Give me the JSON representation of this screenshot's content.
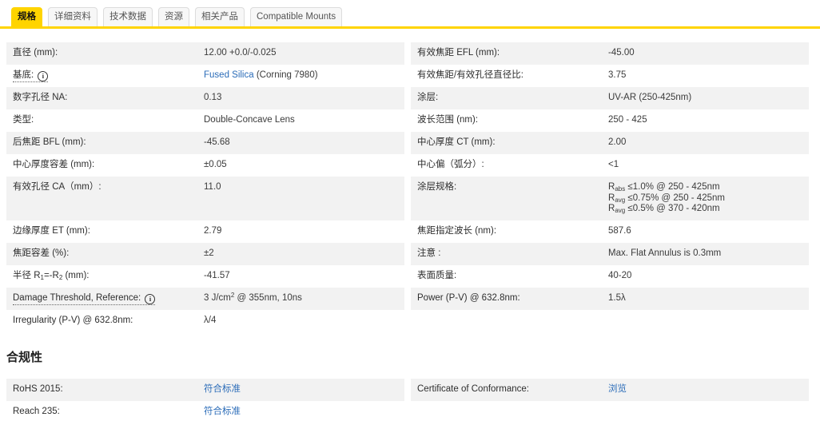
{
  "colors": {
    "accent_yellow": "#ffd400",
    "link_blue": "#2b6cb8",
    "row_gray": "#f2f2f2",
    "text": "#3b3b3b"
  },
  "tabs": [
    {
      "id": "specs",
      "label": "规格",
      "active": true
    },
    {
      "id": "details",
      "label": "详细资料",
      "active": false
    },
    {
      "id": "tech-data",
      "label": "技术数据",
      "active": false
    },
    {
      "id": "resources",
      "label": "资源",
      "active": false
    },
    {
      "id": "related-products",
      "label": "相关产品",
      "active": false
    },
    {
      "id": "compatible-mounts",
      "label": "Compatible Mounts",
      "active": false
    }
  ],
  "spec_rows": [
    {
      "left": {
        "label": [
          {
            "t": "直径 (mm):"
          }
        ],
        "value": [
          {
            "t": "12.00 +0.0/-0.025"
          }
        ]
      },
      "right": {
        "label": [
          {
            "t": "有效焦距 EFL (mm):"
          }
        ],
        "value": [
          {
            "t": "-45.00"
          }
        ]
      }
    },
    {
      "left": {
        "label": [
          {
            "t": "基底: "
          },
          {
            "icon": "info"
          }
        ],
        "dotted": true,
        "value": [
          {
            "link": "Fused Silica"
          },
          {
            "t": " (Corning 7980)"
          }
        ]
      },
      "right": {
        "label": [
          {
            "t": "有效焦距/有效孔径直径比:"
          }
        ],
        "value": [
          {
            "t": "3.75"
          }
        ]
      }
    },
    {
      "left": {
        "label": [
          {
            "t": "数字孔径 NA:"
          }
        ],
        "value": [
          {
            "t": "0.13"
          }
        ]
      },
      "right": {
        "label": [
          {
            "t": "涂层:"
          }
        ],
        "value": [
          {
            "t": "UV-AR (250-425nm)"
          }
        ]
      }
    },
    {
      "left": {
        "label": [
          {
            "t": "类型:"
          }
        ],
        "value": [
          {
            "t": "Double-Concave Lens"
          }
        ]
      },
      "right": {
        "label": [
          {
            "t": "波长范围 (nm):"
          }
        ],
        "value": [
          {
            "t": "250 - 425"
          }
        ]
      }
    },
    {
      "left": {
        "label": [
          {
            "t": "后焦距 BFL (mm):"
          }
        ],
        "value": [
          {
            "t": "-45.68"
          }
        ]
      },
      "right": {
        "label": [
          {
            "t": "中心厚度 CT (mm):"
          }
        ],
        "value": [
          {
            "t": "2.00"
          }
        ]
      }
    },
    {
      "left": {
        "label": [
          {
            "t": "中心厚度容差 (mm):"
          }
        ],
        "value": [
          {
            "t": "±0.05"
          }
        ]
      },
      "right": {
        "label": [
          {
            "t": "中心偏（弧分）:"
          }
        ],
        "value": [
          {
            "t": "<1"
          }
        ]
      }
    },
    {
      "left": {
        "label": [
          {
            "t": "有效孔径 CA（mm）:"
          }
        ],
        "value": [
          {
            "t": "11.0"
          }
        ]
      },
      "right": {
        "label": [
          {
            "t": "涂层规格:"
          }
        ],
        "value": [
          {
            "t": "R"
          },
          {
            "sub": "abs"
          },
          {
            "t": " ≤1.0% @ 250 - 425nm"
          },
          {
            "br": true
          },
          {
            "t": "R"
          },
          {
            "sub": "avg"
          },
          {
            "t": " ≤0.75% @ 250 - 425nm"
          },
          {
            "br": true
          },
          {
            "t": "R"
          },
          {
            "sub": "avg"
          },
          {
            "t": " ≤0.5% @ 370 - 420nm"
          }
        ]
      }
    },
    {
      "left": {
        "label": [
          {
            "t": "边缘厚度 ET (mm):"
          }
        ],
        "value": [
          {
            "t": "2.79"
          }
        ]
      },
      "right": {
        "label": [
          {
            "t": "焦距指定波长 (nm):"
          }
        ],
        "value": [
          {
            "t": "587.6"
          }
        ]
      }
    },
    {
      "left": {
        "label": [
          {
            "t": "焦距容差 (%):"
          }
        ],
        "value": [
          {
            "t": "±2"
          }
        ]
      },
      "right": {
        "label": [
          {
            "t": "注意 :"
          }
        ],
        "value": [
          {
            "t": "Max. Flat Annulus is 0.3mm"
          }
        ]
      }
    },
    {
      "left": {
        "label": [
          {
            "t": "半径 R"
          },
          {
            "sub": "1"
          },
          {
            "t": "=-R"
          },
          {
            "sub": "2"
          },
          {
            "t": " (mm):"
          }
        ],
        "value": [
          {
            "t": "-41.57"
          }
        ]
      },
      "right": {
        "label": [
          {
            "t": "表面质量:"
          }
        ],
        "value": [
          {
            "t": "40-20"
          }
        ]
      }
    },
    {
      "left": {
        "label": [
          {
            "t": "Damage Threshold, Reference: "
          },
          {
            "icon": "info"
          }
        ],
        "dotted": true,
        "value": [
          {
            "t": "3 J/cm"
          },
          {
            "sup": "2"
          },
          {
            "t": " @ 355nm, 10ns"
          }
        ]
      },
      "right": {
        "label": [
          {
            "t": "Power (P-V) @ 632.8nm:"
          }
        ],
        "value": [
          {
            "t": "1.5λ"
          }
        ]
      }
    },
    {
      "left": {
        "label": [
          {
            "t": "Irregularity (P-V) @ 632.8nm:"
          }
        ],
        "value": [
          {
            "t": "λ/4"
          }
        ]
      },
      "right": null
    }
  ],
  "compliance": {
    "heading": "合规性",
    "rows": [
      {
        "left": {
          "label": [
            {
              "t": "RoHS 2015:"
            }
          ],
          "value": [
            {
              "link": "符合标准"
            }
          ]
        },
        "right": {
          "label": [
            {
              "t": "Certificate of Conformance:"
            }
          ],
          "value": [
            {
              "link": "浏览"
            }
          ]
        }
      },
      {
        "left": {
          "label": [
            {
              "t": "Reach 235:"
            }
          ],
          "value": [
            {
              "link": "符合标准"
            }
          ]
        },
        "right": null
      }
    ]
  }
}
